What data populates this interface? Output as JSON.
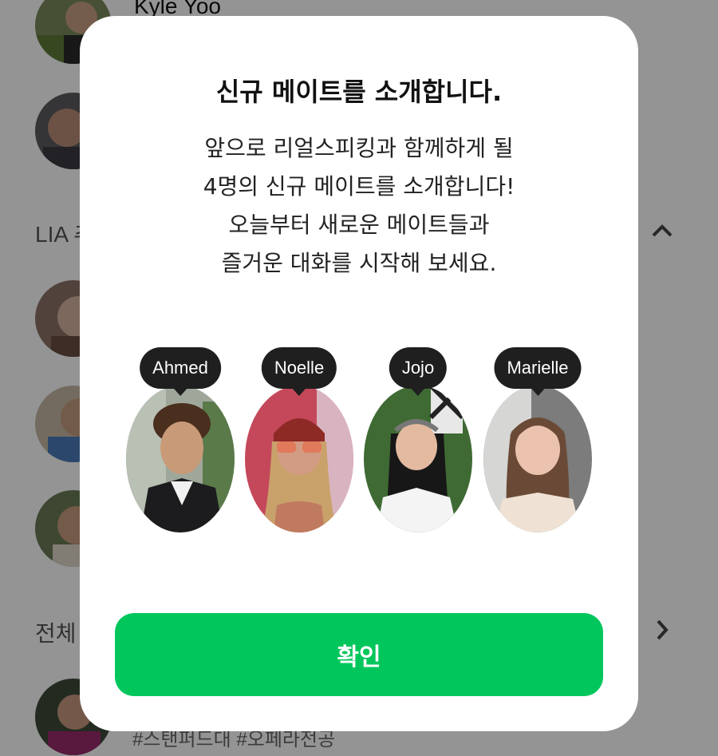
{
  "background": {
    "top_user_name": "Kyle Yoo",
    "section_lia": "LIA 추",
    "section_all": "전체",
    "bottom_tags": "#스탠퍼드대 #오페라전공",
    "chevron_up": "chevron-up-icon",
    "chevron_right": "chevron-right-icon"
  },
  "modal": {
    "title": "신규 메이트를 소개합니다.",
    "body_lines": [
      "앞으로 리얼스피킹과 함께하게 될",
      "4명의 신규 메이트를 소개합니다!",
      "오늘부터 새로운 메이트들과",
      "즐거운 대화를 시작해 보세요."
    ],
    "mates": [
      {
        "name": "Ahmed"
      },
      {
        "name": "Noelle"
      },
      {
        "name": "Jojo"
      },
      {
        "name": "Marielle"
      }
    ],
    "confirm_label": "확인"
  },
  "colors": {
    "accent": "#00c65c",
    "tag_bg": "#1f1f1f",
    "overlay": "rgba(0,0,0,0.42)"
  }
}
